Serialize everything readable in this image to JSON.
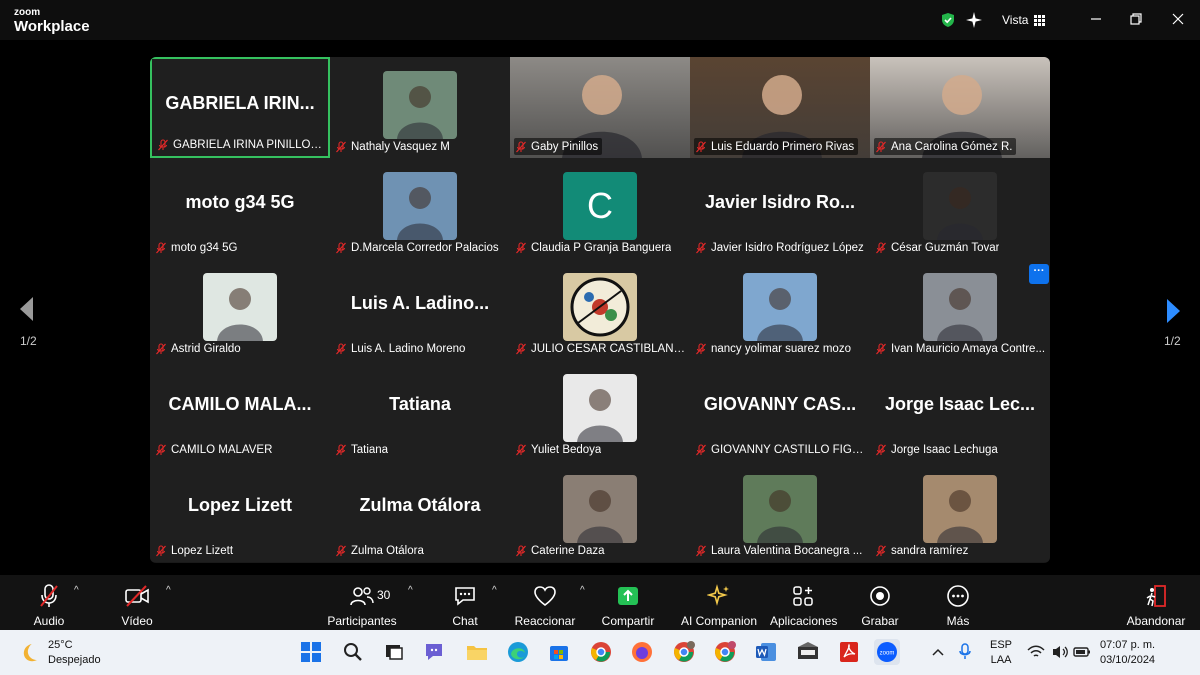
{
  "app": {
    "brand_small": "zoom",
    "brand_large": "Workplace",
    "view_label": "Vista"
  },
  "pages": {
    "left": "1/2",
    "right": "1/2"
  },
  "participants": [
    {
      "display": "GABRIELA  IRIN...",
      "label": "GABRIELA IRINA PINILLOS QUI...",
      "kind": "name",
      "active": true
    },
    {
      "label": "Nathaly Vasquez M",
      "kind": "avatar",
      "icon": "person-photo-icon",
      "color": "#6f8a78"
    },
    {
      "label": "Gaby Pinillos",
      "kind": "video",
      "icon": "video-feed-icon",
      "color": "#8d8a86"
    },
    {
      "label": "Luis Eduardo Primero Rivas",
      "kind": "video",
      "icon": "video-feed-icon",
      "color": "#5a4432"
    },
    {
      "label": "Ana Carolina Gómez R.",
      "kind": "video",
      "icon": "video-feed-icon",
      "color": "#c9c2bb"
    },
    {
      "display": "moto g34 5G",
      "label": "moto g34 5G",
      "kind": "name"
    },
    {
      "label": "D.Marcela Corredor Palacios",
      "kind": "avatar",
      "icon": "person-photo-icon",
      "color": "#6f92b3"
    },
    {
      "display": "C",
      "label": "Claudia P Granja Banguera",
      "kind": "letter",
      "color": "#128b77"
    },
    {
      "display": "Javier  Isidro  Ro...",
      "label": "Javier Isidro Rodríguez López",
      "kind": "name"
    },
    {
      "label": "César Guzmán Tovar",
      "kind": "avatar",
      "icon": "person-photo-icon",
      "color": "#2c2c2c"
    },
    {
      "label": "Astrid Giraldo",
      "kind": "avatar",
      "icon": "person-photo-icon",
      "color": "#dfe7e2"
    },
    {
      "display": "Luis  A.  Ladino...",
      "label": "Luis A. Ladino Moreno",
      "kind": "name"
    },
    {
      "label": "JULIO CÉSAR CASTIBLANCO",
      "kind": "avatar",
      "icon": "abstract-art-icon",
      "color": "#d8c9a3"
    },
    {
      "label": "nancy yolimar suarez mozo",
      "kind": "avatar",
      "icon": "person-photo-icon",
      "color": "#7fa7cf"
    },
    {
      "label": "Ivan Mauricio Amaya Contre...",
      "kind": "avatar",
      "icon": "person-photo-icon",
      "color": "#8a8f96"
    },
    {
      "display": "CAMILO  MALA...",
      "label": "CAMILO MALAVER",
      "kind": "name"
    },
    {
      "display": "Tatiana",
      "label": "Tatiana",
      "kind": "name"
    },
    {
      "label": "Yuliet Bedoya",
      "kind": "avatar",
      "icon": "person-photo-icon",
      "color": "#e9e9e9"
    },
    {
      "display": "GIOVANNY  CAS...",
      "label": "GIOVANNY CASTILLO FIGUE...",
      "kind": "name"
    },
    {
      "display": "Jorge  Isaac  Lec...",
      "label": "Jorge Isaac Lechuga",
      "kind": "name"
    },
    {
      "display": "Lopez Lizett",
      "label": "Lopez Lizett",
      "kind": "name"
    },
    {
      "display": "Zulma Otálora",
      "label": "Zulma Otálora",
      "kind": "name"
    },
    {
      "label": "Caterine Daza",
      "kind": "avatar",
      "icon": "person-photo-icon",
      "color": "#8a7e74"
    },
    {
      "label": "Laura Valentina Bocanegra ...",
      "kind": "avatar",
      "icon": "person-photo-icon",
      "color": "#5f7b5a"
    },
    {
      "label": "sandra ramírez",
      "kind": "avatar",
      "icon": "person-photo-icon",
      "color": "#a58a6e"
    }
  ],
  "toolbar": {
    "audio": "Audio",
    "video": "Vídeo",
    "participants": "Participantes",
    "participants_count": "30",
    "chat": "Chat",
    "react": "Reaccionar",
    "share": "Compartir",
    "companion": "AI Companion",
    "apps": "Aplicaciones",
    "record": "Grabar",
    "more": "Más",
    "leave": "Abandonar"
  },
  "taskbar": {
    "temp": "25°C",
    "weather": "Despejado",
    "lang1": "ESP",
    "lang2": "LAA",
    "time": "07:07 p. m.",
    "date": "03/10/2024"
  },
  "colors": {
    "accent_green": "#35c15f",
    "zoom_blue": "#0e72ed",
    "muted_red": "#e02828"
  }
}
